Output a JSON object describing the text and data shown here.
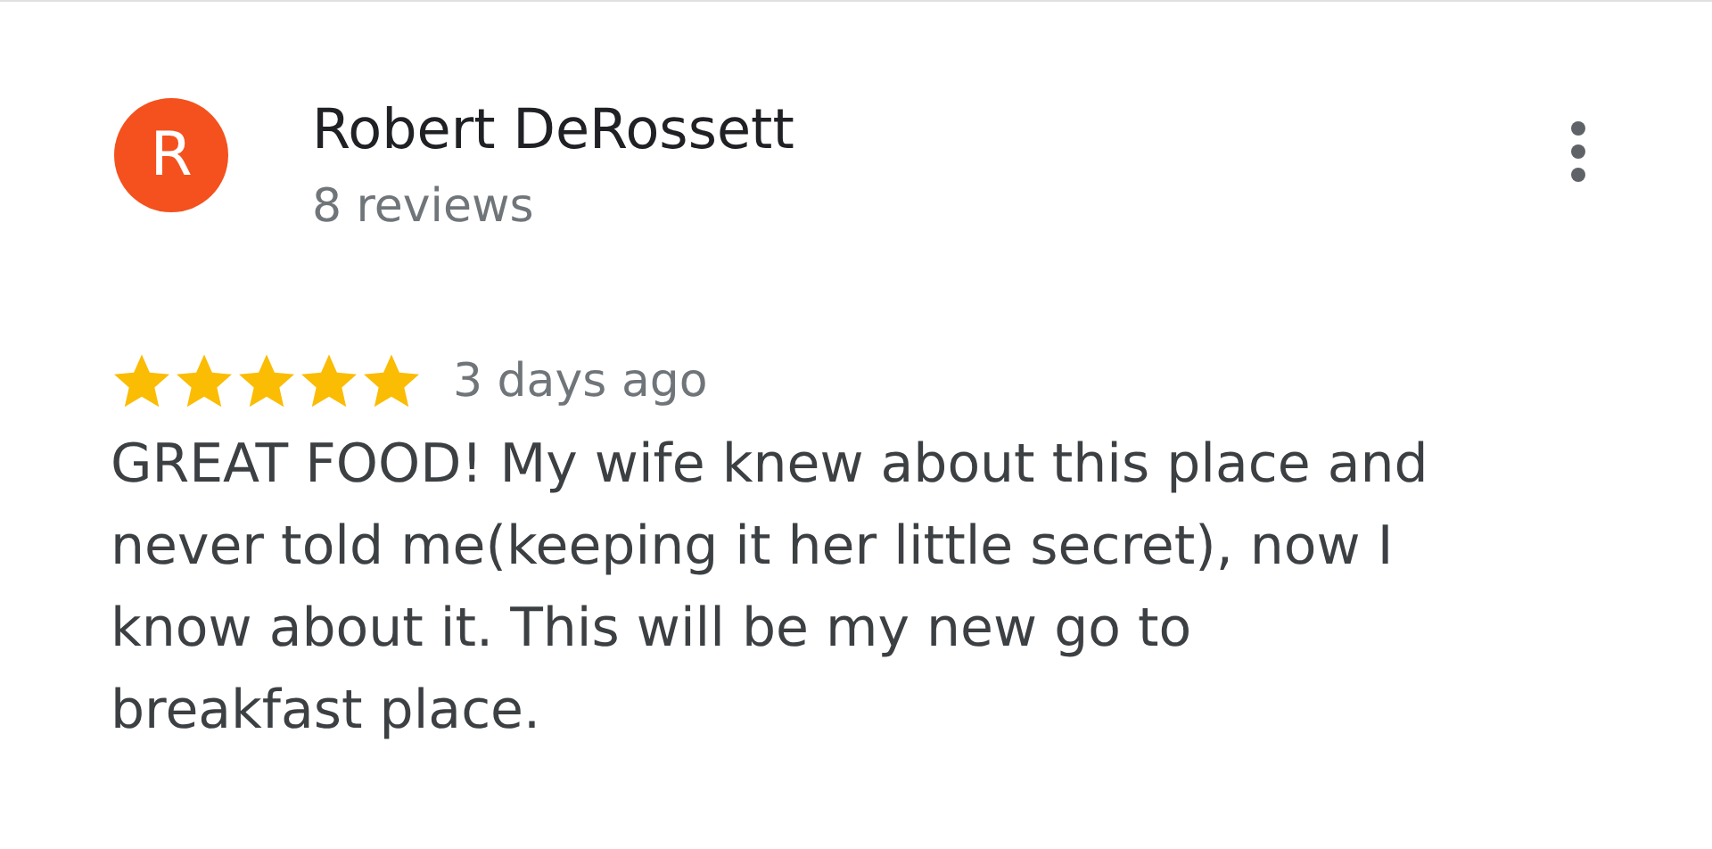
{
  "review": {
    "avatar_letter": "R",
    "author": "Robert DeRossett",
    "author_meta": "8 reviews",
    "stars": 5,
    "time": "3 days ago",
    "text": "GREAT FOOD! My wife knew about this place and never told me(keeping it her little secret), now I know about it. This will be my new go to breakfast place."
  }
}
